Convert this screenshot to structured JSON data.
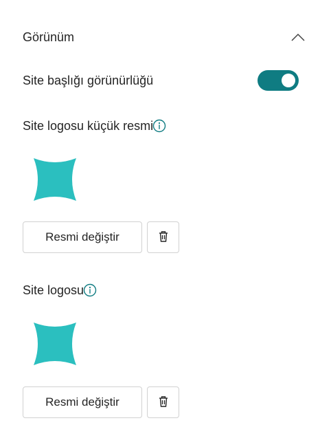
{
  "section": {
    "title": "Görünüm"
  },
  "site_title_visibility": {
    "label": "Site başlığı görünürlüğü",
    "enabled": true
  },
  "thumbnail": {
    "label": "Site logosu küçük resmi",
    "change_button": "Resmi değiştir"
  },
  "site_logo": {
    "label": "Site logosu",
    "change_button": "Resmi değiştir"
  },
  "colors": {
    "accent": "#0f7c82",
    "logo": "#2bbfbf"
  },
  "icons": {
    "collapse": "chevron-up-icon",
    "info": "info-icon",
    "delete": "trash-icon"
  }
}
